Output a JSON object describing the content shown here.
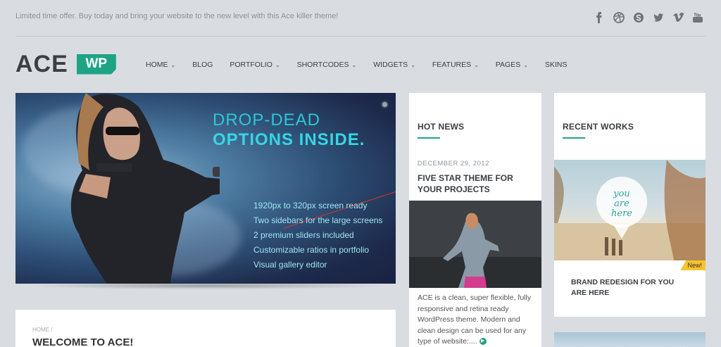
{
  "topbar": {
    "promo": "Limited time offer. Buy today and bring your website to the new level with this Ace killer theme!",
    "socials": [
      "facebook-icon",
      "dribbble-icon",
      "skype-icon",
      "twitter-icon",
      "vimeo-icon",
      "youtube-icon"
    ]
  },
  "logo": {
    "text": "ACE",
    "badge": "WP"
  },
  "nav": {
    "items": [
      {
        "label": "HOME",
        "dropdown": true
      },
      {
        "label": "BLOG",
        "dropdown": false
      },
      {
        "label": "PORTFOLIO",
        "dropdown": true
      },
      {
        "label": "SHORTCODES",
        "dropdown": true
      },
      {
        "label": "WIDGETS",
        "dropdown": true
      },
      {
        "label": "FEATURES",
        "dropdown": true
      },
      {
        "label": "PAGES",
        "dropdown": true
      },
      {
        "label": "SKINS",
        "dropdown": false
      }
    ]
  },
  "slider": {
    "headline1": "DROP-DEAD",
    "headline2": "OPTIONS INSIDE.",
    "features": [
      "1920px to 320px screen ready",
      "Two sidebars for the large screens",
      "2 premium sliders included",
      "Customizable ratios in portfolio",
      "Visual gallery editor"
    ]
  },
  "welcome": {
    "breadcrumb": "HOME /",
    "title": "WELCOME TO ACE!"
  },
  "hot_news": {
    "title": "HOT NEWS",
    "date": "DECEMBER 29, 2012",
    "post_title": "FIVE STAR THEME FOR YOUR PROJECTS",
    "excerpt": "ACE is a clean, super flexible, fully responsive and retina ready WordPress theme. Modern and clean design can be used for any type of website:...."
  },
  "recent_works": {
    "title": "RECENT WORKS",
    "image_text": "you are here",
    "badge": "New!",
    "work_title": "BRAND REDESIGN FOR YOU ARE HERE"
  },
  "colors": {
    "accent": "#1fa385",
    "background": "#d9dde1",
    "highlight": "#36d6e3",
    "badge": "#f6c32d"
  }
}
